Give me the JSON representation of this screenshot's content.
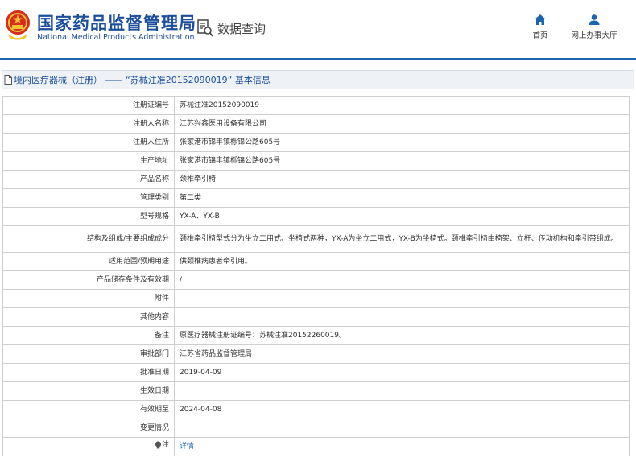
{
  "header": {
    "agency_cn": "国家药品监督管理局",
    "agency_en": "National Medical Products Administration",
    "query_label": "数据查询",
    "nav": [
      {
        "label": "首页",
        "icon": "home-icon"
      },
      {
        "label": "网上办事大厅",
        "icon": "user-icon"
      }
    ],
    "brand_color": "#1b4f9c"
  },
  "breadcrumb": {
    "text": "境内医疗器械（注册） —— “苏械注准20152090019” 基本信息",
    "icon": "document-icon"
  },
  "record": [
    {
      "label": "注册证编号",
      "value": "苏械注准20152090019"
    },
    {
      "label": "注册人名称",
      "value": "江苏兴鑫医用设备有限公司"
    },
    {
      "label": "注册人住所",
      "value": "张家港市锦丰镇栎锦公路605号"
    },
    {
      "label": "生产地址",
      "value": "张家港市锦丰镇栎锦公路605号"
    },
    {
      "label": "产品名称",
      "value": "颈椎牵引椅"
    },
    {
      "label": "管理类别",
      "value": "第二类"
    },
    {
      "label": "型号规格",
      "value": "YX-A、YX-B"
    },
    {
      "label": "结构及组成/主要组成成分",
      "value": "颈椎牵引椅型式分为坐立二用式、坐椅式两种，YX-A为坐立二用式，YX-B为坐椅式。颈椎牵引椅由椅架、立杆、传动机构和牵引带组成。"
    },
    {
      "label": "适用范围/预期用途",
      "value": "供颈椎病患者牵引用。"
    },
    {
      "label": "产品储存条件及有效期",
      "value": "/"
    },
    {
      "label": "附件",
      "value": ""
    },
    {
      "label": "其他内容",
      "value": ""
    },
    {
      "label": "备注",
      "value": "原医疗器械注册证编号：苏械注准20152260019。"
    },
    {
      "label": "审批部门",
      "value": "江苏省药品监督管理局"
    },
    {
      "label": "批准日期",
      "value": "2019-04-09"
    },
    {
      "label": "生效日期",
      "value": ""
    },
    {
      "label": "有效期至",
      "value": "2024-04-08"
    },
    {
      "label": "变更情况",
      "value": ""
    },
    {
      "label": "注",
      "value": "详情",
      "icon": "lightbulb-icon"
    }
  ]
}
